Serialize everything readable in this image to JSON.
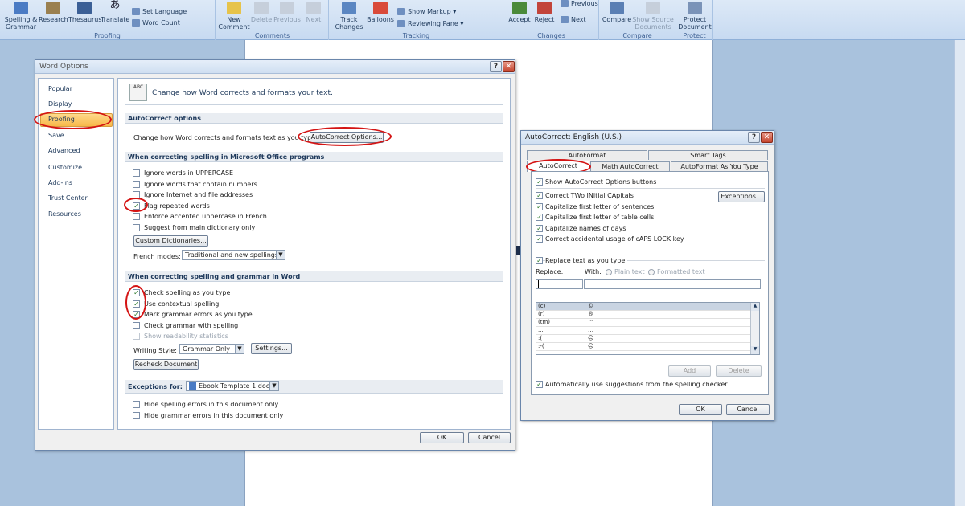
{
  "ribbon": {
    "proofing": {
      "caption": "Proofing",
      "spelling": "Spelling &\nGrammar",
      "research": "Research",
      "thesaurus": "Thesaurus",
      "translate": "Translate",
      "set_language": "Set Language",
      "word_count": "Word Count"
    },
    "comments": {
      "caption": "Comments",
      "new": "New\nComment",
      "delete": "Delete",
      "previous": "Previous",
      "next": "Next"
    },
    "tracking": {
      "caption": "Tracking",
      "track_changes": "Track\nChanges",
      "balloons": "Balloons",
      "show_markup": "Show Markup",
      "reviewing_pane": "Reviewing Pane"
    },
    "changes": {
      "caption": "Changes",
      "accept": "Accept",
      "reject": "Reject",
      "previous": "Previous",
      "next": "Next"
    },
    "compare": {
      "caption": "Compare",
      "compare": "Compare",
      "show_source": "Show Source\nDocuments"
    },
    "protect": {
      "caption": "Protect",
      "protect_doc": "Protect\nDocument"
    }
  },
  "word_options": {
    "title": "Word Options",
    "nav": [
      "Popular",
      "Display",
      "Proofing",
      "Save",
      "Advanced",
      "Customize",
      "Add-Ins",
      "Trust Center",
      "Resources"
    ],
    "header": "Change how Word corrects and formats your text.",
    "autocorrect_section": "AutoCorrect options",
    "autocorrect_text": "Change how Word corrects and formats text as you type:",
    "autocorrect_btn": "AutoCorrect Options...",
    "spelling_section": "When correcting spelling in Microsoft Office programs",
    "spelling_opts": [
      {
        "label": "Ignore words in UPPERCASE",
        "checked": false
      },
      {
        "label": "Ignore words that contain numbers",
        "checked": false
      },
      {
        "label": "Ignore Internet and file addresses",
        "checked": false
      },
      {
        "label": "Flag repeated words",
        "checked": true
      },
      {
        "label": "Enforce accented uppercase in French",
        "checked": false
      },
      {
        "label": "Suggest from main dictionary only",
        "checked": false
      }
    ],
    "custom_dict_btn": "Custom Dictionaries...",
    "french_modes_label": "French modes:",
    "french_modes_value": "Traditional and new spellings",
    "grammar_section": "When correcting spelling and grammar in Word",
    "grammar_opts": [
      {
        "label": "Check spelling as you type",
        "checked": true
      },
      {
        "label": "Use contextual spelling",
        "checked": true
      },
      {
        "label": "Mark grammar errors as you type",
        "checked": true
      },
      {
        "label": "Check grammar with spelling",
        "checked": false
      },
      {
        "label": "Show readability statistics",
        "checked": false
      }
    ],
    "writing_style_label": "Writing Style:",
    "writing_style_value": "Grammar Only",
    "settings_btn": "Settings...",
    "recheck_btn": "Recheck Document",
    "exceptions_label": "Exceptions for:",
    "exceptions_value": "Ebook Template 1.doc",
    "exceptions_opts": [
      {
        "label": "Hide spelling errors in this document only",
        "checked": false
      },
      {
        "label": "Hide grammar errors in this document only",
        "checked": false
      }
    ],
    "ok": "OK",
    "cancel": "Cancel"
  },
  "autocorrect": {
    "title": "AutoCorrect: English (U.S.)",
    "tabs_row1": [
      "AutoFormat",
      "Smart Tags"
    ],
    "tabs_row2": [
      "AutoCorrect",
      "Math AutoCorrect",
      "AutoFormat As You Type"
    ],
    "show_buttons": "Show AutoCorrect Options buttons",
    "opts": [
      "Correct TWo INitial CApitals",
      "Capitalize first letter of sentences",
      "Capitalize first letter of table cells",
      "Capitalize names of days",
      "Correct accidental usage of cAPS LOCK key"
    ],
    "exceptions_btn": "Exceptions...",
    "replace_as_type": "Replace text as you type",
    "replace_label": "Replace:",
    "with_label": "With:",
    "plain_text": "Plain text",
    "formatted_text": "Formatted text",
    "rows": [
      {
        "from": "(c)",
        "to": "©"
      },
      {
        "from": "(r)",
        "to": "®"
      },
      {
        "from": "(tm)",
        "to": "™"
      },
      {
        "from": "...",
        "to": "…"
      },
      {
        "from": ":(",
        "to": "☹"
      },
      {
        "from": ":-(",
        "to": "☹"
      }
    ],
    "add_btn": "Add",
    "delete_btn": "Delete",
    "auto_suggest": "Automatically use suggestions from the spelling checker",
    "ok": "OK",
    "cancel": "Cancel"
  }
}
